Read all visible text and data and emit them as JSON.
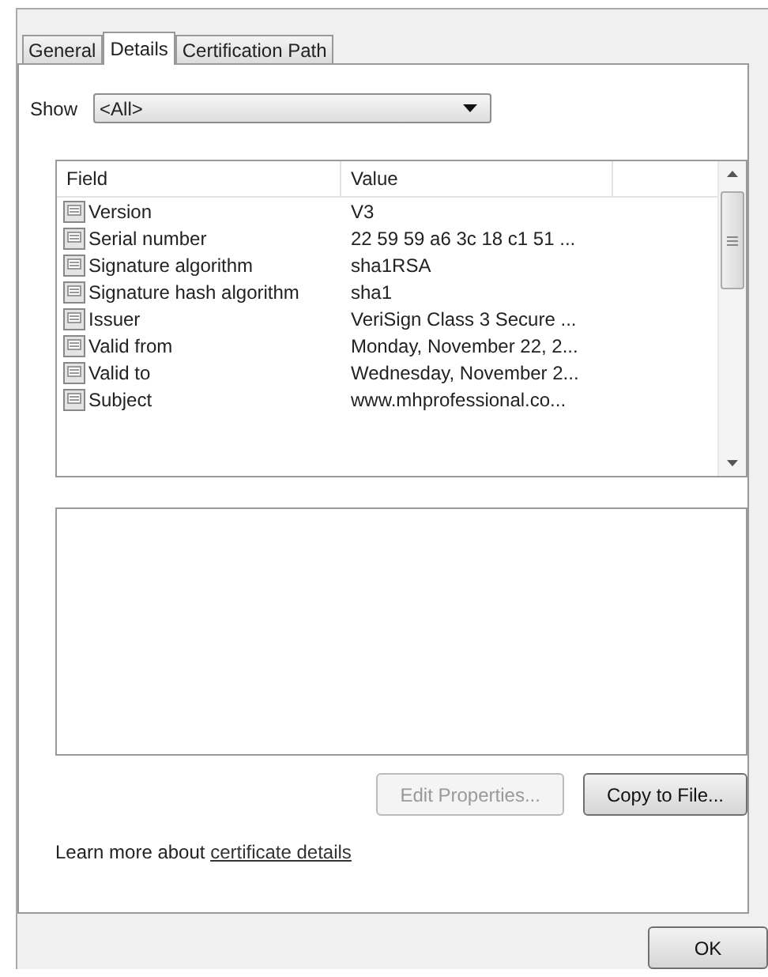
{
  "tabs": [
    {
      "label": "General",
      "selected": false
    },
    {
      "label": "Details",
      "selected": true
    },
    {
      "label": "Certification Path",
      "selected": false
    }
  ],
  "show": {
    "label": "Show",
    "value": "<All>"
  },
  "table": {
    "columns": [
      "Field",
      "Value"
    ],
    "rows": [
      {
        "field": "Version",
        "value": "V3"
      },
      {
        "field": "Serial number",
        "value": "22 59 59 a6 3c 18 c1 51 ..."
      },
      {
        "field": "Signature algorithm",
        "value": "sha1RSA"
      },
      {
        "field": "Signature hash algorithm",
        "value": "sha1"
      },
      {
        "field": "Issuer",
        "value": "VeriSign Class 3 Secure ..."
      },
      {
        "field": "Valid from",
        "value": "Monday, November 22, 2..."
      },
      {
        "field": "Valid to",
        "value": "Wednesday, November 2..."
      },
      {
        "field": "Subject",
        "value": "www.mhprofessional.co..."
      }
    ]
  },
  "buttons": [
    {
      "label": "Edit Properties...",
      "disabled": true
    },
    {
      "label": "Copy to File...",
      "disabled": false
    }
  ],
  "learn_more": {
    "text": "Learn more about",
    "link": "certificate details"
  },
  "ok_button": "OK"
}
